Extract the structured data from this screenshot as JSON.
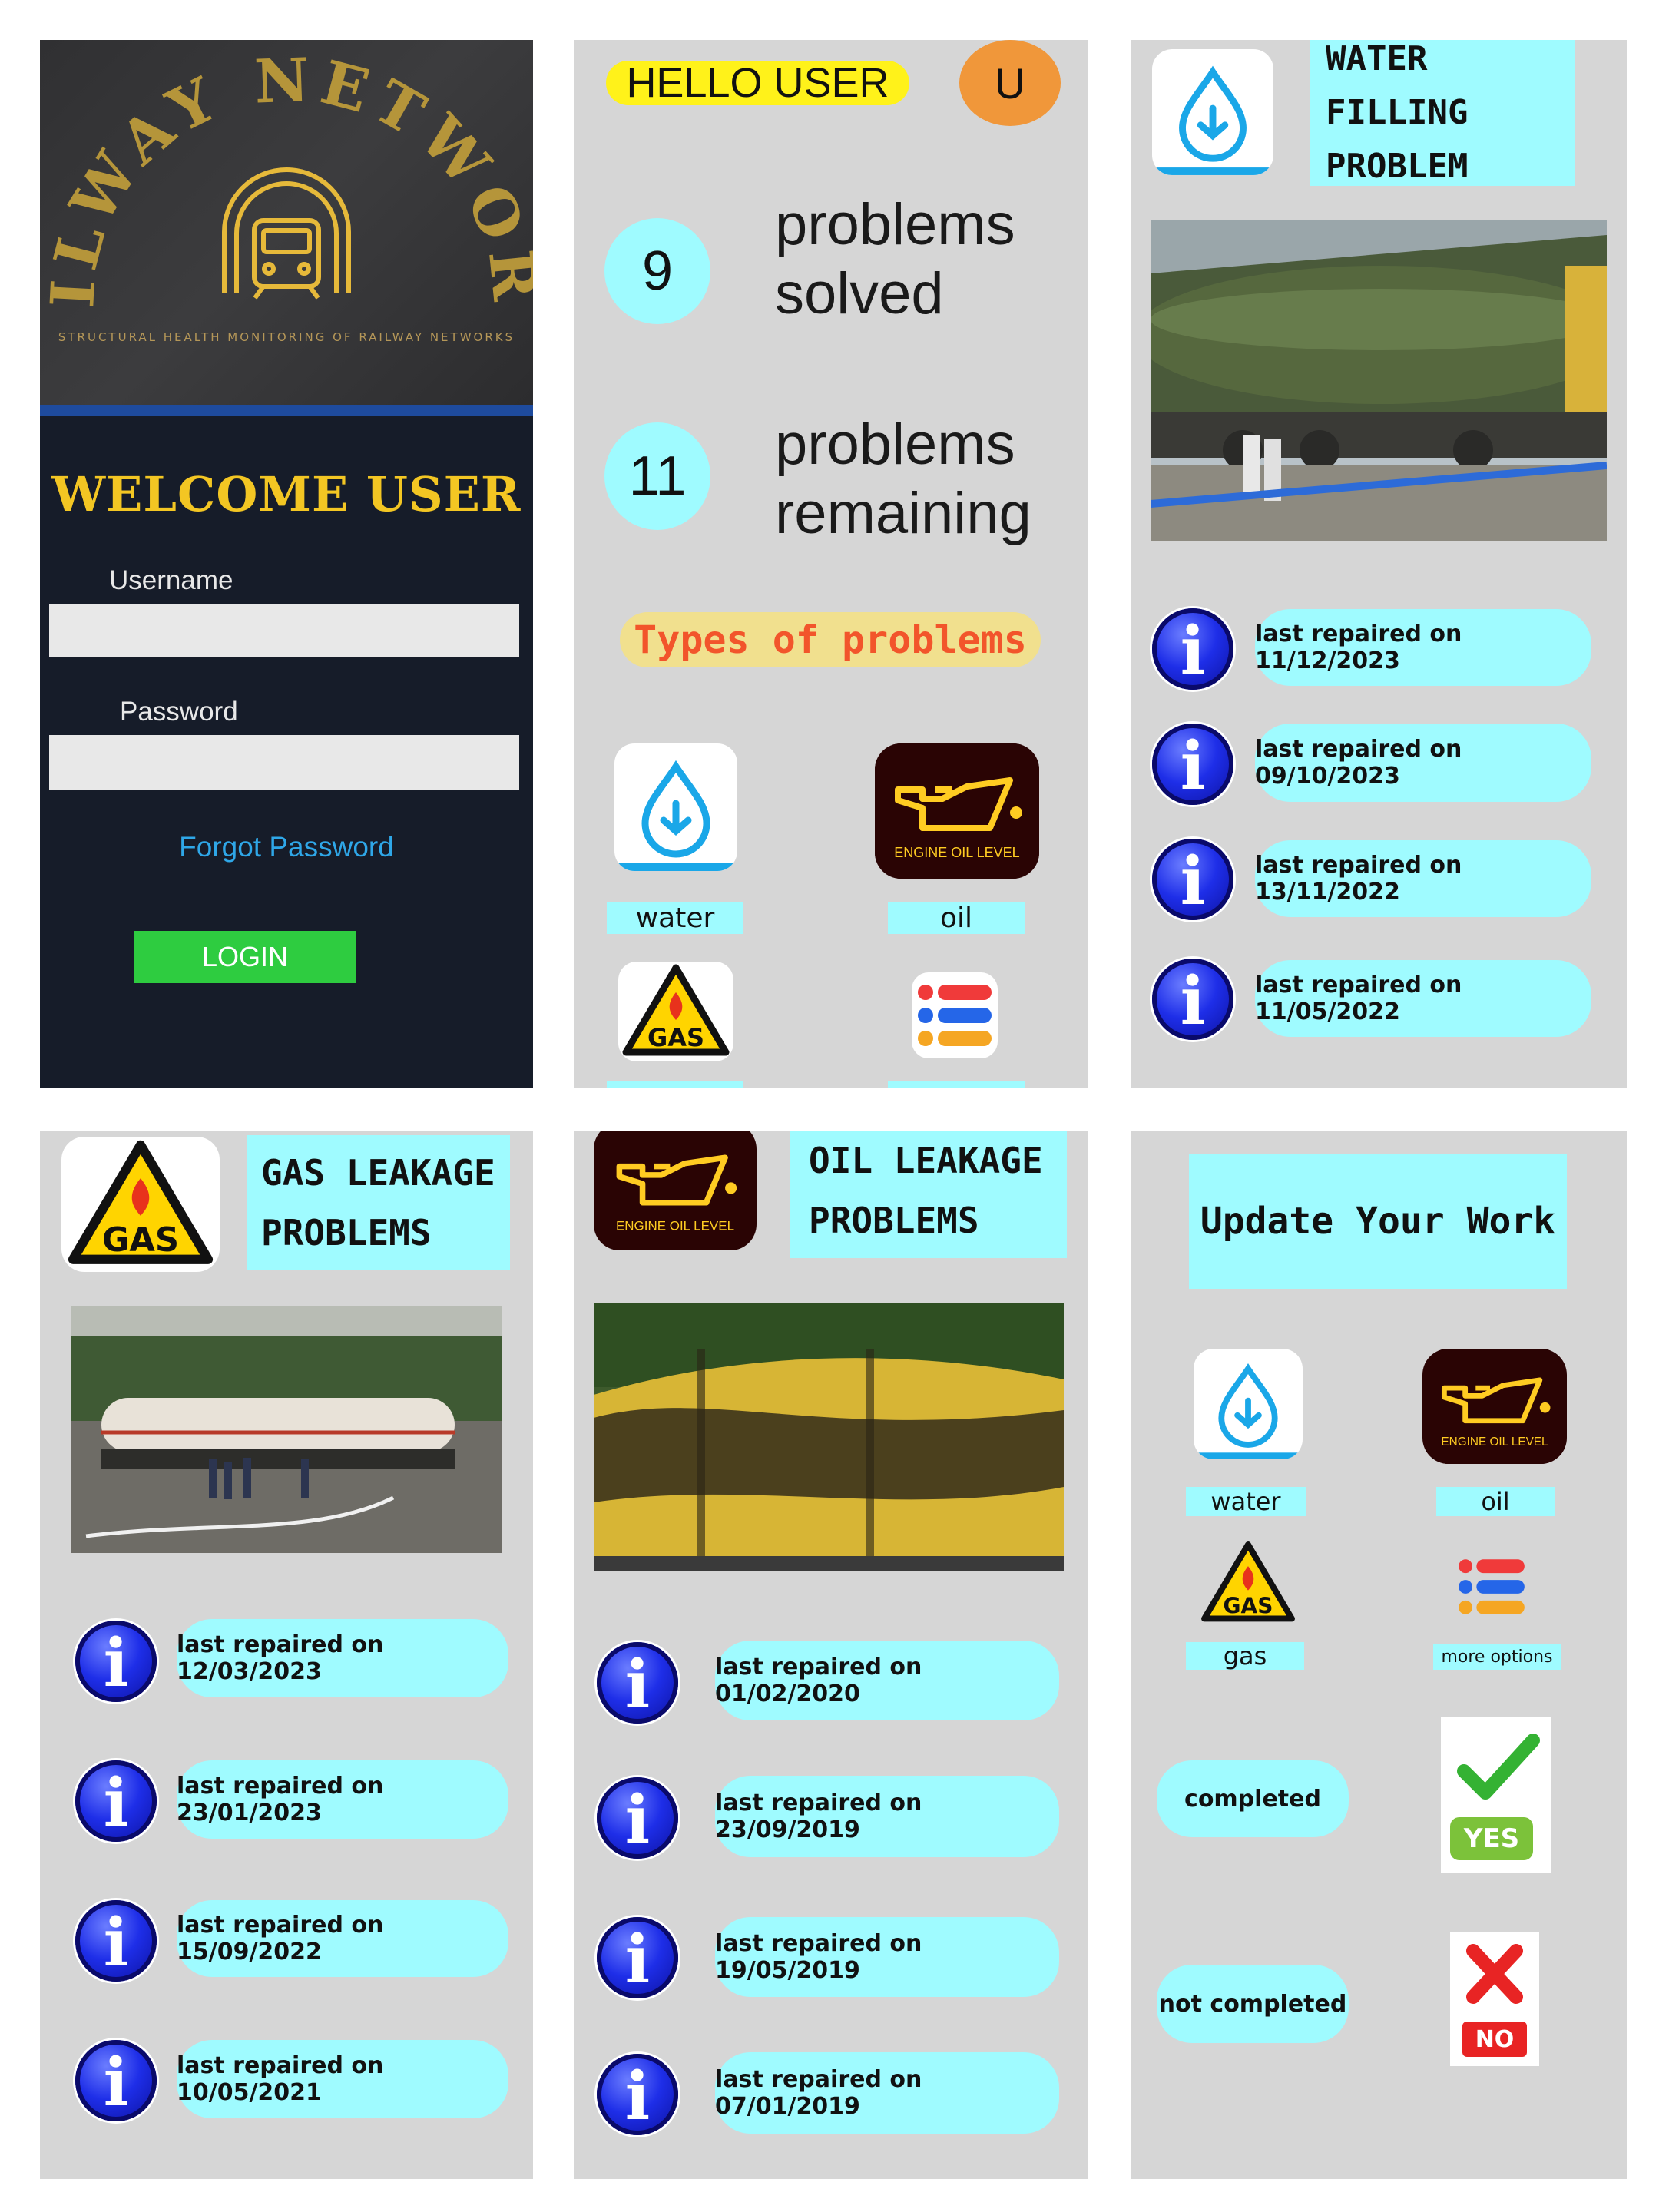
{
  "login": {
    "brand_arc": "RAILWAY NETWORKS",
    "subtitle": "STRUCTURAL HEALTH MONITORING OF RAILWAY NETWORKS",
    "welcome": "WELCOME USER",
    "username_label": "Username",
    "username_value": "",
    "password_label": "Password",
    "password_value": "",
    "forgot": "Forgot Password",
    "login_button": "LOGIN"
  },
  "dashboard": {
    "greeting": "HELLO USER",
    "avatar_letter": "U",
    "solved_count": "9",
    "solved_label_1": "problems",
    "solved_label_2": "solved",
    "remaining_count": "11",
    "remaining_label_1": "problems",
    "remaining_label_2": "remaining",
    "types_heading": "Types of problems",
    "types": [
      "water",
      "oil"
    ],
    "oil_icon_text": "ENGINE OIL LEVEL"
  },
  "water": {
    "title_1": "WATER FILLING",
    "title_2": "PROBLEM",
    "repairs": [
      "last repaired on 11/12/2023",
      "last repaired on 09/10/2023",
      "last repaired on 13/11/2022",
      "last repaired on 11/05/2022"
    ]
  },
  "gas": {
    "title_1": "GAS LEAKAGE",
    "title_2": "PROBLEMS",
    "icon_text": "GAS",
    "repairs": [
      "last repaired on 12/03/2023",
      "last repaired on 23/01/2023",
      "last repaired on 15/09/2022",
      "last repaired on 10/05/2021"
    ]
  },
  "oil": {
    "title_1": "OIL LEAKAGE",
    "title_2": "PROBLEMS",
    "icon_text": "ENGINE OIL LEVEL",
    "repairs": [
      "last repaired on 01/02/2020",
      "last repaired on 23/09/2019",
      "last repaired on 19/05/2019",
      "last repaired on 07/01/2019"
    ]
  },
  "update": {
    "title": "Update Your Work",
    "labels": [
      "water",
      "oil",
      "gas",
      "more options"
    ],
    "oil_icon_text": "ENGINE OIL LEVEL",
    "gas_icon_text": "GAS",
    "completed": "completed",
    "not_completed": "not completed",
    "yes": "YES",
    "no": "NO"
  },
  "colors": {
    "panel_grey": "#d6d6d6",
    "accent_cyan": "#9ffbff",
    "login_bg": "#161c29",
    "login_green": "#2ecc40",
    "gold": "#e8c31c",
    "avatar_orange": "#f0973a",
    "hello_yellow": "#fff21a"
  }
}
